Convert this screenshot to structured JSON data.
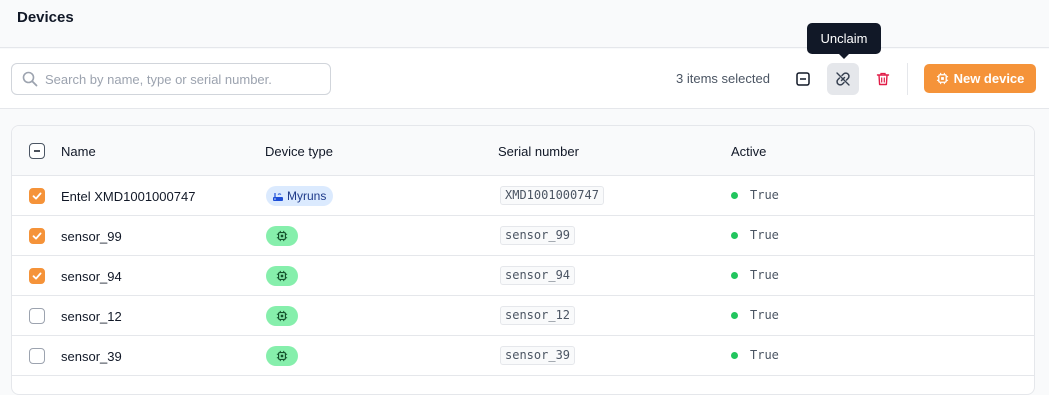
{
  "header": {
    "title": "Devices"
  },
  "toolbar": {
    "search_placeholder": "Search by name, type or serial number.",
    "search_value": "",
    "selected_count": "3 items selected",
    "deselect_icon": "minus-square-icon",
    "unclaim_icon": "unlink-icon",
    "delete_icon": "trash-icon",
    "new_device_label": "New device",
    "tooltip": "Unclaim"
  },
  "table": {
    "columns": [
      "Name",
      "Device type",
      "Serial number",
      "Active"
    ],
    "header_checkbox": "indeterminate",
    "rows": [
      {
        "checked": true,
        "name": "Entel XMD1001000747",
        "type_label": "Myruns",
        "type_icon": "router-icon",
        "serial": "XMD1001000747",
        "active": "True"
      },
      {
        "checked": true,
        "name": "sensor_99",
        "type_label": "",
        "type_icon": "chip-icon",
        "serial": "sensor_99",
        "active": "True"
      },
      {
        "checked": true,
        "name": "sensor_94",
        "type_label": "",
        "type_icon": "chip-icon",
        "serial": "sensor_94",
        "active": "True"
      },
      {
        "checked": false,
        "name": "sensor_12",
        "type_label": "",
        "type_icon": "chip-icon",
        "serial": "sensor_12",
        "active": "True"
      },
      {
        "checked": false,
        "name": "sensor_39",
        "type_label": "",
        "type_icon": "chip-icon",
        "serial": "sensor_39",
        "active": "True"
      }
    ]
  },
  "colors": {
    "accent": "#f59339",
    "active": "#22c55e",
    "delete": "#e11d48",
    "type_badge": "#dbeafe",
    "chip_badge": "#86efac"
  }
}
